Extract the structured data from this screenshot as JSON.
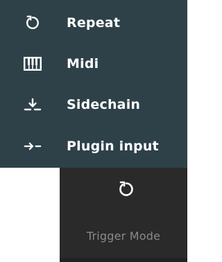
{
  "menu": {
    "items": [
      {
        "label": "Repeat",
        "icon": "repeat-icon"
      },
      {
        "label": "Midi",
        "icon": "piano-keys-icon"
      },
      {
        "label": "Sidechain",
        "icon": "sidechain-icon"
      },
      {
        "label": "Plugin input",
        "icon": "plugin-input-icon"
      }
    ]
  },
  "trigger": {
    "label": "Trigger Mode",
    "icon": "repeat-icon"
  },
  "colors": {
    "menu_bg": "#2e4149",
    "panel_bg": "#2a2a2a",
    "text": "#ffffff",
    "muted_text": "#8a8a8a"
  }
}
